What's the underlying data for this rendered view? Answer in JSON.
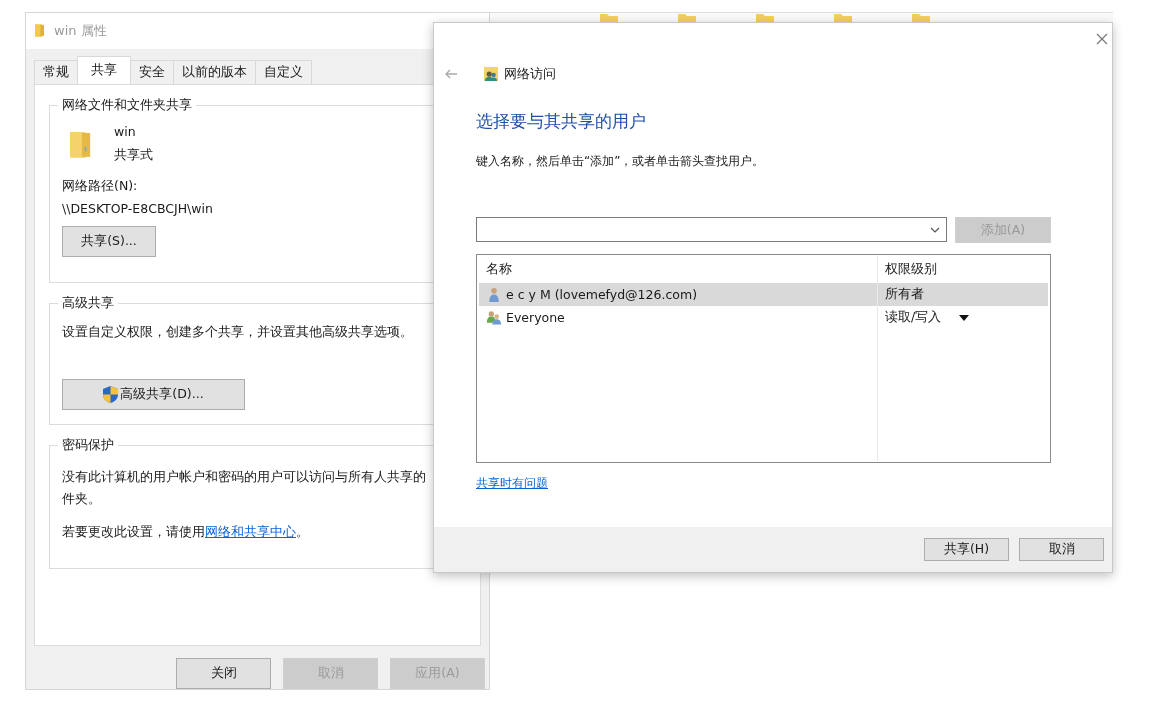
{
  "properties_window": {
    "title": "win 属性",
    "tabs": [
      {
        "label": "常规",
        "selected": false
      },
      {
        "label": "共享",
        "selected": true
      },
      {
        "label": "安全",
        "selected": false
      },
      {
        "label": "以前的版本",
        "selected": false
      },
      {
        "label": "自定义",
        "selected": false
      }
    ],
    "network_sharing": {
      "heading": "网络文件和文件夹共享",
      "folder_name": "win",
      "status": "共享式",
      "path_label": "网络路径(N):",
      "path": "\\\\DESKTOP-E8CBCJH\\win",
      "share_button": "共享(S)..."
    },
    "advanced_sharing": {
      "heading": "高级共享",
      "description": "设置自定义权限，创建多个共享，并设置其他高级共享选项。",
      "button": "高级共享(D)..."
    },
    "password_protection": {
      "heading": "密码保护",
      "lines": [
        "没有此计算机的用户帐户和密码的用户可以访问与所有人共享的",
        "件夹。"
      ],
      "change_prefix": "若要更改此设置，请使用",
      "link": "网络和共享中心",
      "change_suffix": "。"
    },
    "buttons": [
      {
        "label": "关闭",
        "disabled": false
      },
      {
        "label": "取消",
        "disabled": true
      },
      {
        "label": "应用(A)",
        "disabled": true
      }
    ]
  },
  "share_dialog": {
    "title": "网络访问",
    "heading": "选择要与其共享的用户",
    "instruction": "键入名称，然后单击“添加”，或者单击箭头查找用户。",
    "add_button": {
      "label": "添加(A)",
      "disabled": true
    },
    "columns": [
      "名称",
      "权限级别"
    ],
    "rows": [
      {
        "kind": "user",
        "name": "e c y M (lovemefyd@126.com)",
        "permission": "所有者",
        "selected": true,
        "has_dropdown": false
      },
      {
        "kind": "group",
        "name": "Everyone",
        "permission": "读取/写入",
        "selected": false,
        "has_dropdown": true
      }
    ],
    "help_link": "共享时有问题",
    "buttons": [
      {
        "label": "共享(H)",
        "disabled": false
      },
      {
        "label": "取消",
        "disabled": false
      }
    ]
  }
}
